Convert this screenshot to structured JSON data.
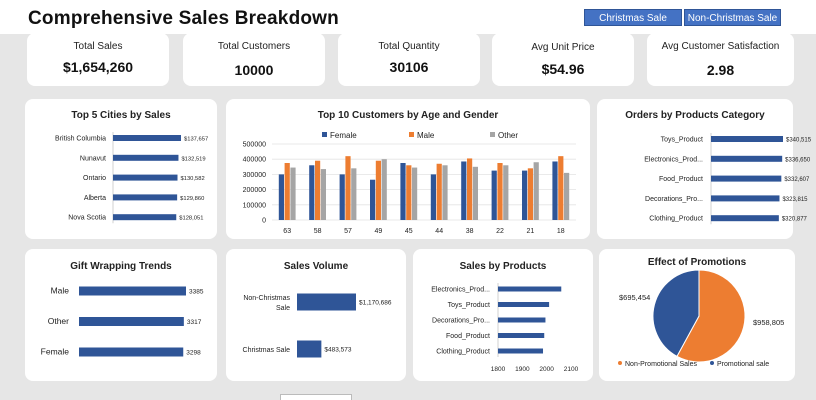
{
  "dashboard": {
    "title": "Comprehensive Sales Breakdown",
    "slicers": [
      "Christmas Sale",
      "Non-Christmas Sale"
    ]
  },
  "kpis": [
    {
      "label": "Total Sales",
      "value": "$1,654,260"
    },
    {
      "label": "Total Customers",
      "value": "10000"
    },
    {
      "label": "Total Quantity",
      "value": "30106"
    },
    {
      "label": "Avg  Unit Price",
      "value": "$54.96"
    },
    {
      "label": "Avg Customer Satisfaction",
      "value": "2.98"
    }
  ],
  "colors": {
    "blue": "#2f5597",
    "orange": "#ed7d31",
    "gray": "#a5a5a5",
    "pie_blue": "#2f5597",
    "pie_orange": "#ed7d31"
  },
  "chart_data": [
    {
      "id": "cities",
      "type": "bar",
      "orientation": "horizontal",
      "title": "Top 5 Cities  by Sales",
      "categories": [
        "British Columbia",
        "Nunavut",
        "Ontario",
        "Alberta",
        "Nova Scotia"
      ],
      "values": [
        137657,
        132519,
        130582,
        129860,
        128051
      ],
      "value_labels": [
        "$137,657",
        "$132,519",
        "$130,582",
        "$129,860",
        "$128,051"
      ]
    },
    {
      "id": "customers",
      "type": "bar",
      "title": "Top 10 Customers by Age and Gender",
      "categories": [
        "63",
        "58",
        "57",
        "49",
        "45",
        "44",
        "38",
        "22",
        "21",
        "18"
      ],
      "series": [
        {
          "name": "Female",
          "values": [
            300000,
            360000,
            300000,
            265000,
            375000,
            300000,
            385000,
            325000,
            325000,
            385000
          ]
        },
        {
          "name": "Male",
          "values": [
            375000,
            390000,
            420000,
            390000,
            360000,
            370000,
            405000,
            375000,
            340000,
            420000
          ]
        },
        {
          "name": "Other",
          "values": [
            345000,
            335000,
            340000,
            400000,
            345000,
            360000,
            350000,
            360000,
            380000,
            310000
          ]
        }
      ],
      "yticks": [
        "500000",
        "400000",
        "300000",
        "200000",
        "100000",
        "0"
      ],
      "ylim": [
        0,
        500000
      ],
      "legend": "top"
    },
    {
      "id": "categories",
      "type": "bar",
      "orientation": "horizontal",
      "title": "Orders by  Products Category",
      "categories": [
        "Toys_Product",
        "Electronics_Prod...",
        "Food_Product",
        "Decorations_Pro...",
        "Clothing_Product"
      ],
      "values": [
        340515,
        336650,
        332607,
        323815,
        320877
      ],
      "value_labels": [
        "$340,515",
        "$336,650",
        "$332,607",
        "$323,815",
        "$320,877"
      ]
    },
    {
      "id": "gift",
      "type": "bar",
      "orientation": "horizontal",
      "title": "Gift Wrapping Trends",
      "categories": [
        "Male",
        "Other",
        "Female"
      ],
      "values": [
        3385,
        3317,
        3298
      ],
      "value_labels": [
        "3385",
        "3317",
        "3298"
      ]
    },
    {
      "id": "volume",
      "type": "bar",
      "orientation": "horizontal",
      "title": "Sales Volume",
      "categories": [
        "Non-Christmas Sale",
        "Christmas Sale"
      ],
      "category_lines": [
        [
          "Non-Christmas",
          "Sale"
        ],
        [
          "Christmas Sale"
        ]
      ],
      "values": [
        1170686,
        483573
      ],
      "value_labels": [
        "$1,170,686",
        "$483,573"
      ]
    },
    {
      "id": "products",
      "type": "bar",
      "orientation": "horizontal",
      "title": "Sales by Products",
      "categories": [
        "Electronics_Prod...",
        "Toys_Product",
        "Decorations_Pro...",
        "Food_Product",
        "Clothing_Product"
      ],
      "values": [
        2060,
        2010,
        1995,
        1990,
        1985
      ],
      "xticks": [
        "1800",
        "1900",
        "2000",
        "2100"
      ],
      "xlim": [
        1800,
        2100
      ]
    },
    {
      "id": "promotions",
      "type": "pie",
      "title": "Effect of Promotions",
      "labels": [
        "Non-Promotional Sales",
        "Promotional sale"
      ],
      "values": [
        958805,
        695454
      ],
      "value_labels": [
        "$958,805",
        "$695,454"
      ],
      "legend": "bottom"
    }
  ]
}
